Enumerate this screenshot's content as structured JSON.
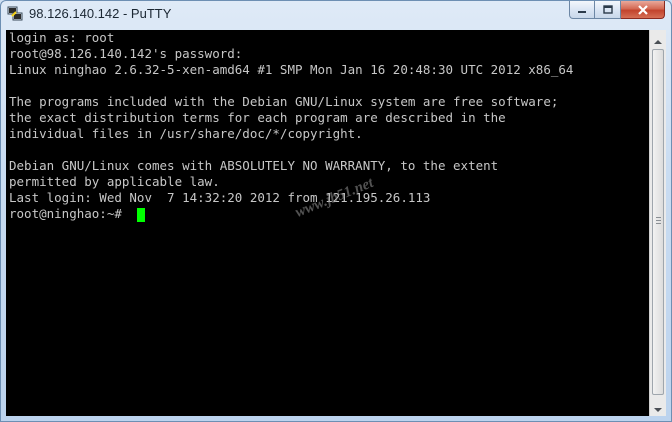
{
  "window": {
    "title": "98.126.140.142 - PuTTY",
    "icon": "putty-app-icon",
    "controls": [
      "minimize-icon",
      "maximize-icon",
      "close-icon"
    ]
  },
  "terminal": {
    "lines": [
      "login as: root",
      "root@98.126.140.142's password:",
      "Linux ninghao 2.6.32-5-xen-amd64 #1 SMP Mon Jan 16 20:48:30 UTC 2012 x86_64",
      "",
      "The programs included with the Debian GNU/Linux system are free software;",
      "the exact distribution terms for each program are described in the",
      "individual files in /usr/share/doc/*/copyright.",
      "",
      "Debian GNU/Linux comes with ABSOLUTELY NO WARRANTY, to the extent",
      "permitted by applicable law.",
      "Last login: Wed Nov  7 14:32:20 2012 from 121.195.26.113",
      "root@ninghao:~# "
    ],
    "colors": {
      "background": "#000000",
      "foreground": "#c7c7c7",
      "cursor": "#00ff00"
    }
  },
  "watermark": "www.jb51.net"
}
